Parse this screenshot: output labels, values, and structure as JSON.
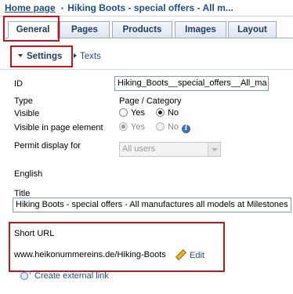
{
  "breadcrumb": {
    "home": "Home page",
    "separator": "•",
    "current": "Hiking Boots - special offers - All m..."
  },
  "tabs": [
    {
      "label": "General",
      "active": true
    },
    {
      "label": "Pages",
      "active": false
    },
    {
      "label": "Products",
      "active": false
    },
    {
      "label": "Images",
      "active": false
    },
    {
      "label": "Layout",
      "active": false
    }
  ],
  "subtabs": {
    "settings": "Settings",
    "texts": "Texts"
  },
  "form": {
    "id_label": "ID",
    "id_value": "Hiking_Boots__special_offers__All_ma",
    "type_label": "Type",
    "type_value": "Page / Category",
    "visible_label": "Visible",
    "visible_yes": "Yes",
    "visible_no": "No",
    "visible_selected": "No",
    "visible_in_element_label": "Visible in page element",
    "visible_in_element_yes": "Yes",
    "visible_in_element_no": "No",
    "visible_in_element_selected": "Yes",
    "permit_label": "Permit display for",
    "permit_value": "All users",
    "language": "English",
    "title_label": "Title",
    "title_value": "Hiking Boots - special offers - All manufactures all models at Milestones"
  },
  "short_url": {
    "label": "Short URL",
    "url": "www.heikonummereins.de/Hiking-Boots",
    "edit_label": "Edit"
  },
  "external_link": {
    "label": "Create external link"
  },
  "colors": {
    "link": "#1f4e8c",
    "highlight_box": "#c0181d",
    "info_icon": "#3a6fc0"
  }
}
